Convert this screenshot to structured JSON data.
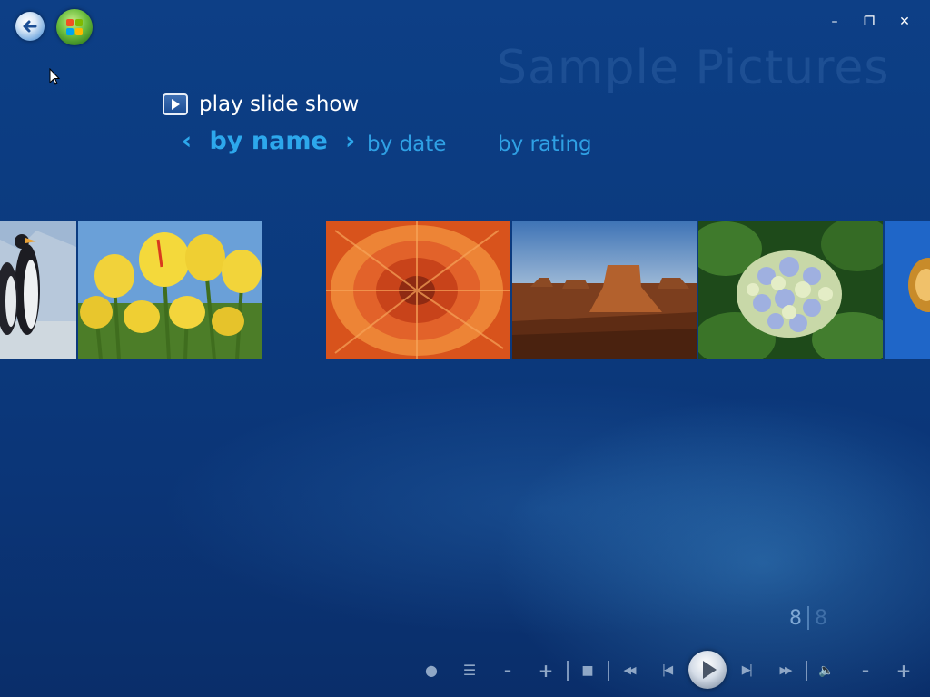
{
  "window": {
    "folder_title": "Sample Pictures",
    "minimize_glyph": "–",
    "restore_glyph": "❐",
    "close_glyph": "✕"
  },
  "nav": {
    "back_icon": "back-arrow-icon",
    "start_icon": "windows-start-orb-icon"
  },
  "slideshow": {
    "label": "play slide show",
    "icon": "play-slideshow-icon"
  },
  "sort": {
    "tabs": [
      {
        "label": "by name",
        "selected": true,
        "prev": "‹",
        "next": "›"
      },
      {
        "label": "by date",
        "selected": false
      },
      {
        "label": "by rating",
        "selected": false
      }
    ]
  },
  "gallery": {
    "thumbnails": [
      {
        "subject": "penguins"
      },
      {
        "subject": "tulips"
      },
      {
        "subject": "chrysanthemum"
      },
      {
        "subject": "desert"
      },
      {
        "subject": "hydrangeas"
      },
      {
        "subject": "koala"
      }
    ]
  },
  "counter": {
    "current": "8",
    "total": "8"
  },
  "transport": {
    "controls": [
      {
        "name": "record-icon",
        "glyph": "●"
      },
      {
        "name": "guide-list-icon",
        "glyph": "☰"
      },
      {
        "name": "channel-down-icon",
        "glyph": "–"
      },
      {
        "name": "channel-up-icon",
        "glyph": "+"
      },
      {
        "name": "stop-icon",
        "glyph": "■"
      },
      {
        "name": "rewind-icon",
        "glyph": "◀◀"
      },
      {
        "name": "skip-back-icon",
        "glyph": "|◀"
      },
      {
        "name": "play-icon",
        "glyph": "▶"
      },
      {
        "name": "skip-forward-icon",
        "glyph": "▶|"
      },
      {
        "name": "fast-forward-icon",
        "glyph": "▶▶"
      },
      {
        "name": "mute-icon",
        "glyph": "🔈"
      },
      {
        "name": "volume-down-icon",
        "glyph": "–"
      },
      {
        "name": "volume-up-icon",
        "glyph": "+"
      }
    ]
  },
  "colors": {
    "background": "#0b3a7e",
    "accent": "#2da8ec",
    "text": "#ffffff"
  }
}
